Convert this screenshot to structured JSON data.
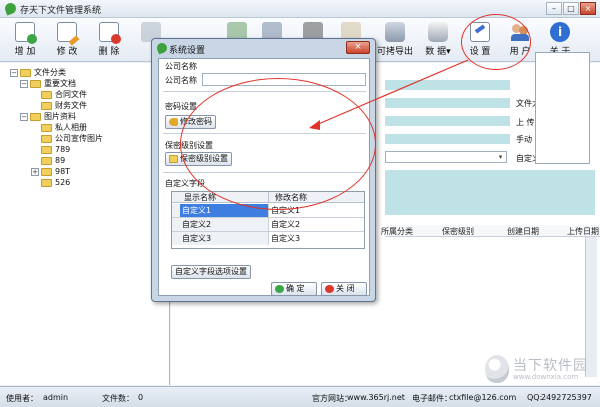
{
  "window": {
    "title": "存天下文件管理系统",
    "close_glyph": "×",
    "max_glyph": "□",
    "min_glyph": "–"
  },
  "toolbar": {
    "add": "增 加",
    "edit": "修 改",
    "delete": "删 除",
    "export": "可拷导出",
    "data": "数 据",
    "settings": "设 置",
    "users": "用 户",
    "about": "关 于",
    "dropdown_glyph": "▾"
  },
  "tree": {
    "root": "文件分类",
    "items": [
      {
        "label": "重要文档",
        "level": 1,
        "expander": "−"
      },
      {
        "label": "合同文件",
        "level": 2,
        "expander": ""
      },
      {
        "label": "财务文件",
        "level": 2,
        "expander": ""
      },
      {
        "label": "图片资料",
        "level": 1,
        "expander": "−"
      },
      {
        "label": "私人相册",
        "level": 2,
        "expander": ""
      },
      {
        "label": "公司宣传图片",
        "level": 2,
        "expander": ""
      },
      {
        "label": "789",
        "level": 2,
        "expander": ""
      },
      {
        "label": "89",
        "level": 2,
        "expander": ""
      },
      {
        "label": "98T",
        "level": 2,
        "expander": "+"
      },
      {
        "label": "526",
        "level": 2,
        "expander": ""
      }
    ]
  },
  "details": {
    "labels": [
      "文件大",
      "上 传",
      "手动",
      "自定义"
    ],
    "grid_headers": [
      "所属分类",
      "保密级别",
      "创建日期",
      "上传日期"
    ]
  },
  "dialog": {
    "title": "系统设置",
    "close_label": "×",
    "company_section": "公司名称",
    "company_label": "公司名称",
    "company_value": "",
    "password_section": "密码设置",
    "password_button": "修改密码",
    "secrecy_section": "保密级别设置",
    "secrecy_button": "保密级别设置",
    "custom_section": "自定义字段",
    "table_headers": [
      "显示名称",
      "修改名称"
    ],
    "rows": [
      {
        "display": "自定义1",
        "modify": "自定义1"
      },
      {
        "display": "自定义2",
        "modify": "自定义2"
      },
      {
        "display": "自定义3",
        "modify": "自定义3"
      }
    ],
    "custom_options_button": "自定义字段选项设置",
    "ok_button": "确 定",
    "close_button": "关 闭"
  },
  "status": {
    "user_label": "使用者：",
    "user_value": "admin",
    "files_label": "文件数：",
    "files_value": "0",
    "website_label": "官方网站：",
    "website_value": "www.365rj.net",
    "email_label": "电子邮件：",
    "email_value": "ctxfile@126.com",
    "qq_label": "QQ:",
    "qq_value": "2492725397"
  },
  "watermark": {
    "brand": "当下软件园",
    "url": "www.downxia.com"
  },
  "colors": {
    "accent": "#3e7ee0",
    "annotation": "#e0342a",
    "panel_cyan": "#bfe2e6"
  }
}
